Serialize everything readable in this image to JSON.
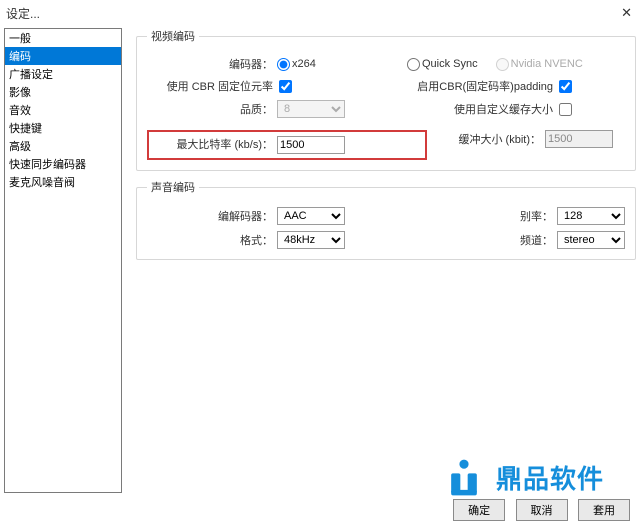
{
  "window": {
    "title": "设定..."
  },
  "sidebar": {
    "items": [
      {
        "label": "一般"
      },
      {
        "label": "编码"
      },
      {
        "label": "广播设定"
      },
      {
        "label": "影像"
      },
      {
        "label": "音效"
      },
      {
        "label": "快捷键"
      },
      {
        "label": "高级"
      },
      {
        "label": "快速同步编码器"
      },
      {
        "label": "麦克风噪音阀"
      }
    ],
    "selected_index": 1
  },
  "video": {
    "legend": "视频编码",
    "encoder_label": "编码器：",
    "encoders": {
      "x264": "x264",
      "quicksync": "Quick Sync",
      "nvenc": "Nvidia NVENC",
      "selected": "x264"
    },
    "use_cbr_label": "使用 CBR 固定位元率",
    "use_cbr_checked": true,
    "enable_cbr_padding_label": "启用CBR(固定码率)padding",
    "enable_cbr_padding_checked": true,
    "quality_label": "品质：",
    "quality_value": "8",
    "custom_buffer_label": "使用自定义缓存大小",
    "custom_buffer_checked": false,
    "max_bitrate_label": "最大比特率 (kb/s)：",
    "max_bitrate_value": "1500",
    "buffer_size_label": "缓冲大小 (kbit)：",
    "buffer_size_value": "1500"
  },
  "audio": {
    "legend": "声音编码",
    "codec_label": "编解码器：",
    "codec_value": "AAC",
    "bitrate_label": "别率：",
    "bitrate_value": "128",
    "format_label": "格式：",
    "format_value": "48kHz",
    "channel_label": "频道：",
    "channel_value": "stereo"
  },
  "buttons": {
    "ok": "确定",
    "cancel": "取消",
    "apply": "套用"
  },
  "watermark": {
    "text": "鼎品软件"
  }
}
